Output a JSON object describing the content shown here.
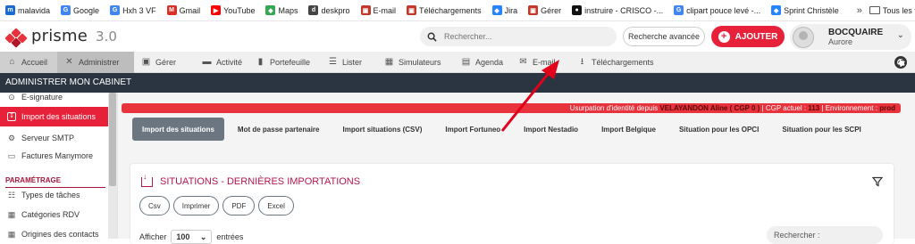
{
  "bookmarks": [
    {
      "label": "malavida",
      "color": "#1a6bd0",
      "glyph": "m"
    },
    {
      "label": "Google",
      "color": "#4285f4",
      "glyph": "G"
    },
    {
      "label": "Hxh 3 VF",
      "color": "#4285f4",
      "glyph": "G"
    },
    {
      "label": "Gmail",
      "color": "#d93025",
      "glyph": "M"
    },
    {
      "label": "YouTube",
      "color": "#ff0000",
      "glyph": "▶"
    },
    {
      "label": "Maps",
      "color": "#34a853",
      "glyph": "◆"
    },
    {
      "label": "deskpro",
      "color": "#444444",
      "glyph": "d"
    },
    {
      "label": "E-mail",
      "color": "#c0392b",
      "glyph": "▣"
    },
    {
      "label": "Téléchargements",
      "color": "#c0392b",
      "glyph": "▣"
    },
    {
      "label": "Jira",
      "color": "#2684ff",
      "glyph": "◆"
    },
    {
      "label": "Gérer",
      "color": "#c0392b",
      "glyph": "▣"
    },
    {
      "label": "instruire - CRISCO -...",
      "color": "#111111",
      "glyph": "●"
    },
    {
      "label": "clipart pouce levé -...",
      "color": "#4285f4",
      "glyph": "G"
    },
    {
      "label": "Sprint Christèle",
      "color": "#2684ff",
      "glyph": "◆"
    }
  ],
  "bookmarks_more": "»",
  "bookmarks_all": "Tous les favoris",
  "app": {
    "name": "prisme",
    "version": "3.0"
  },
  "search": {
    "placeholder": "Rechercher..."
  },
  "advanced_search": "Recherche avancée",
  "add_button": "AJOUTER",
  "user": {
    "name": "BOCQUAIRE",
    "first": "Aurore"
  },
  "nav": [
    {
      "label": "Accueil",
      "icon": "⌂"
    },
    {
      "label": "Administrer",
      "icon": "✕"
    },
    {
      "label": "Gérer",
      "icon": "▣"
    },
    {
      "label": "Activité",
      "icon": "▬"
    },
    {
      "label": "Portefeuille",
      "icon": "▮"
    },
    {
      "label": "Lister",
      "icon": "☰"
    },
    {
      "label": "Simulateurs",
      "icon": "▦"
    },
    {
      "label": "Agenda",
      "icon": "▤"
    },
    {
      "label": "E-mail",
      "icon": "✉"
    },
    {
      "label": "Téléchargements",
      "icon": "⭳"
    }
  ],
  "admin_bar": "ADMINISTRER MON CABINET",
  "sidebar": {
    "items": [
      {
        "label": "E-signature",
        "icon": "⊙"
      },
      {
        "label": "Import des situations",
        "icon": "↧"
      },
      {
        "label": "Serveur SMTP",
        "icon": "⚙"
      },
      {
        "label": "Factures Manymore",
        "icon": "▭"
      }
    ],
    "section": "PARAMÉTRAGE",
    "items2": [
      {
        "label": "Types de tâches",
        "icon": "☷"
      },
      {
        "label": "Catégories RDV",
        "icon": "▦"
      },
      {
        "label": "Origines des contacts",
        "icon": "▦"
      }
    ]
  },
  "alert": {
    "prefix": "Usurpation d'identité depuis",
    "user": "VELAYANDON Aline ( CGP 0 )",
    "cgp_label": "| CGP actuel :",
    "cgp_value": "113",
    "env_label": "| Environnement :",
    "env_value": "prod"
  },
  "tabs": [
    "Import des situations",
    "Mot de passe partenaire",
    "Import situations (CSV)",
    "Import Fortuneo",
    "Import Nestadio",
    "Import Belgique",
    "Situation pour les OPCI",
    "Situation pour les SCPI"
  ],
  "card": {
    "title": "SITUATIONS - DERNIÈRES IMPORTATIONS",
    "buttons": [
      "Csv",
      "Imprimer",
      "PDF",
      "Excel"
    ],
    "show_label": "Afficher",
    "page_size": "100",
    "entries_label": "entrées",
    "search_label": "Rechercher :"
  },
  "colors": {
    "accent": "#e8213a",
    "dark": "#2b3541",
    "title": "#b4174a"
  }
}
